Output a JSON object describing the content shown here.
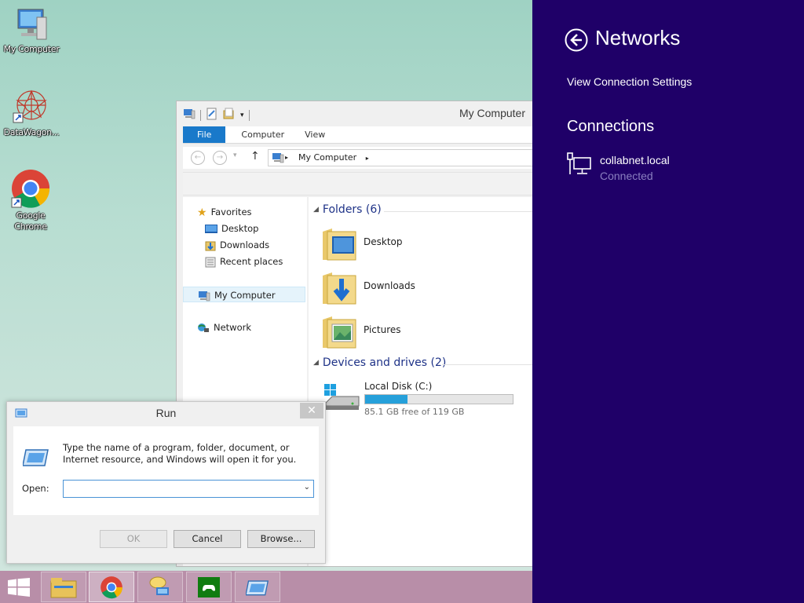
{
  "desktop": {
    "icons": [
      {
        "label": "My Computer",
        "icon": "computer-icon"
      },
      {
        "label": "DataWagon...",
        "icon": "datawagon-icon"
      },
      {
        "label": "Google Chrome",
        "icon": "chrome-icon"
      }
    ]
  },
  "explorer": {
    "title": "My Computer",
    "tabs": [
      "File",
      "Computer",
      "View"
    ],
    "address": "My Computer",
    "nav": {
      "favorites": "Favorites",
      "desktop": "Desktop",
      "downloads": "Downloads",
      "recent": "Recent places",
      "my_computer": "My Computer",
      "network": "Network"
    },
    "folders_header": "Folders (6)",
    "folders": [
      "Desktop",
      "Downloads",
      "Pictures"
    ],
    "devices_header": "Devices and drives (2)",
    "drive": {
      "name": "Local Disk (C:)",
      "free_text": "85.1 GB free of 119 GB",
      "used_fraction": 0.285
    }
  },
  "run_dialog": {
    "title": "Run",
    "close": "✕",
    "description": "Type the name of a program, folder, document, or Internet resource, and Windows will open it for you.",
    "open_label": "Open:",
    "open_value": "",
    "ok": "OK",
    "cancel": "Cancel",
    "browse": "Browse..."
  },
  "taskbar": {
    "items": [
      "start-icon",
      "file-explorer-icon",
      "chrome-icon",
      "network-chat-icon",
      "xbox-games-icon",
      "run-icon"
    ],
    "color": "#b88ea8"
  },
  "charm": {
    "title": "Networks",
    "view_settings": "View Connection Settings",
    "connections_header": "Connections",
    "network_name": "collabnet.local",
    "network_status": "Connected",
    "bg_color": "#1f0068"
  }
}
